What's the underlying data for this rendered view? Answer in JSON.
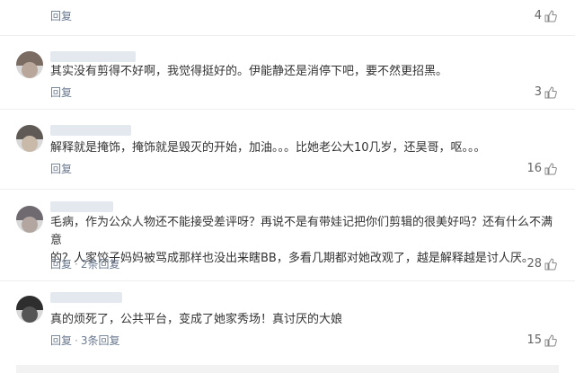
{
  "comments": [
    {
      "text": "",
      "reply": "回复",
      "likes": "4",
      "show_user": false
    },
    {
      "text": "其实没有剪得不好啊，我觉得挺好的。伊能静还是消停下吧，要不然更招黑。",
      "reply": "回复",
      "likes": "3",
      "show_user": true
    },
    {
      "text": "解释就是掩饰，掩饰就是毁灭的开始，加油。。。比她老公大10几岁，还昊哥，呕。。。",
      "reply": "回复",
      "likes": "16",
      "show_user": true
    },
    {
      "text_line1": "毛病，作为公众人物还不能接受差评呀？再说不是有带娃记把你们剪辑的很美好吗？还有什么不满意",
      "text_line2": "的？人家饺子妈妈被骂成那样也没出来瞎BB，多看几期都对她改观了，越是解释越是讨人厌。",
      "reply": "回复",
      "replies_link": "2条回复",
      "likes": "28",
      "show_user": true
    },
    {
      "text": "真的烦死了，公共平台，变成了她家秀场！真讨厌的大娘",
      "reply": "回复",
      "replies_link": "3条回复",
      "likes": "15",
      "show_user": true
    }
  ],
  "colors": {
    "link": "#6b7a8f",
    "text": "#333333",
    "like_icon": "#888888"
  },
  "icons": {
    "like": "thumbs-up-icon"
  }
}
